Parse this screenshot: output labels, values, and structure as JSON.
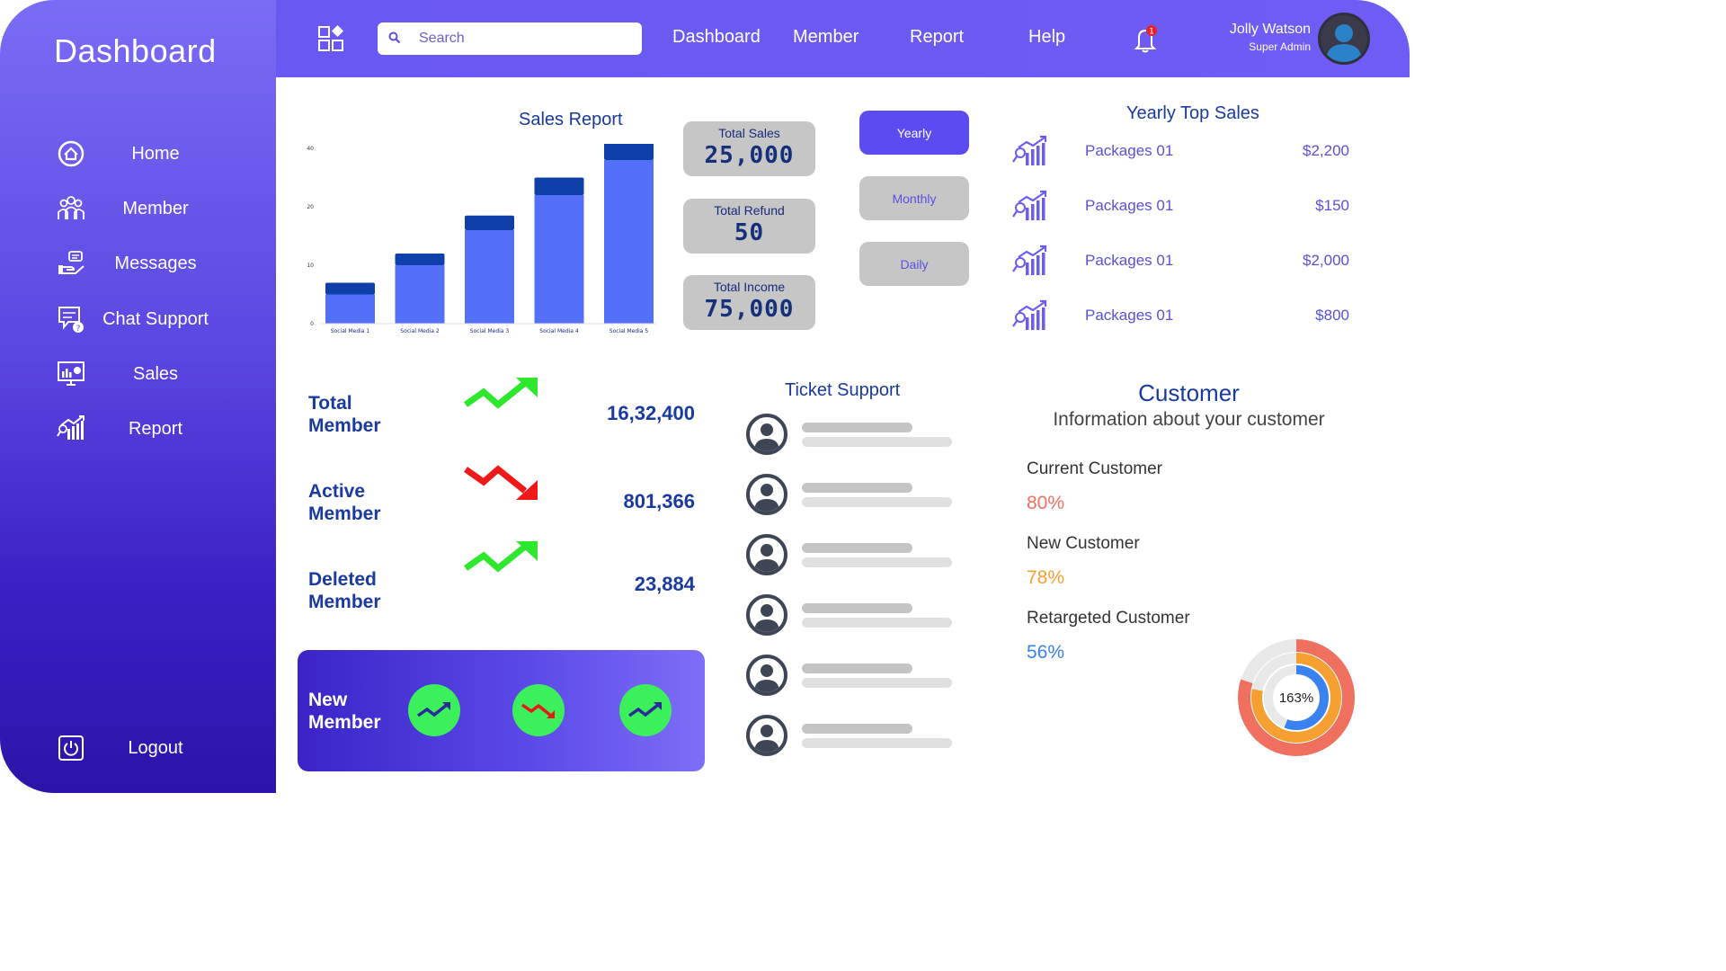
{
  "sidebar": {
    "brand": "Dashboard",
    "items": [
      {
        "label": "Home",
        "icon": "home-icon"
      },
      {
        "label": "Member",
        "icon": "group-icon"
      },
      {
        "label": "Messages",
        "icon": "hand-message-icon"
      },
      {
        "label": "Chat Support",
        "icon": "chat-support-icon"
      },
      {
        "label": "Sales",
        "icon": "monitor-chart-icon"
      },
      {
        "label": "Report",
        "icon": "report-chart-icon"
      }
    ],
    "logout": {
      "label": "Logout",
      "icon": "power-icon"
    }
  },
  "topbar": {
    "search_placeholder": "Search",
    "nav": [
      "Dashboard",
      "Member",
      "Report",
      "Help"
    ],
    "notification_count": "1",
    "user": {
      "name": "Jolly Watson",
      "role": "Super Admin"
    }
  },
  "sales_report": {
    "title": "Sales Report",
    "chart_data": {
      "type": "bar",
      "categories": [
        "Social Media 1",
        "Social Media 2",
        "Social Media 3",
        "Social Media 4",
        "Social Media 5"
      ],
      "series": [
        {
          "values": [
            5,
            10,
            16,
            22,
            28
          ],
          "color": "#5570f8"
        },
        {
          "values": [
            2,
            2,
            2.5,
            3,
            3
          ],
          "color": "#0f3fa8"
        }
      ],
      "y_ticks": [
        "0",
        "10",
        "20",
        "40"
      ],
      "stacked": true,
      "grid": false
    }
  },
  "stats": [
    {
      "title": "Total Sales",
      "value": "25,000"
    },
    {
      "title": "Total Refund",
      "value": "50"
    },
    {
      "title": "Total Income",
      "value": "75,000"
    }
  ],
  "period": {
    "options": [
      "Yearly",
      "Monthly",
      "Daily"
    ],
    "selected": "Yearly"
  },
  "top_sales": {
    "title": "Yearly Top Sales",
    "items": [
      {
        "name": "Packages 01",
        "amount": "$2,200"
      },
      {
        "name": "Packages 01",
        "amount": "$150"
      },
      {
        "name": "Packages 01",
        "amount": "$2,000"
      },
      {
        "name": "Packages 01",
        "amount": "$800"
      }
    ]
  },
  "members": [
    {
      "label_line1": "Total",
      "label_line2": "Member",
      "value": "16,32,400",
      "trend": "up"
    },
    {
      "label_line1": "Active",
      "label_line2": "Member",
      "value": "801,366",
      "trend": "down"
    },
    {
      "label_line1": "Deleted",
      "label_line2": "Member",
      "value": "23,884",
      "trend": "up"
    }
  ],
  "new_member": {
    "label_line1": "New",
    "label_line2": "Member",
    "trends": [
      "up",
      "down",
      "up"
    ]
  },
  "ticket_support": {
    "title": "Ticket Support",
    "rows": 6
  },
  "customer": {
    "title": "Customer",
    "subtitle": "Information about your customer",
    "items": [
      {
        "label": "Current Customer",
        "value": "80%",
        "color": "#f07060"
      },
      {
        "label": "New Customer",
        "value": "78%",
        "color": "#f5a030"
      },
      {
        "label": "Retargeted Customer",
        "value": "56%",
        "color": "#3a82f0"
      }
    ],
    "donut_label": "163%",
    "donut_colors": [
      "#f07060",
      "#f5a030",
      "#3a82f0"
    ]
  }
}
